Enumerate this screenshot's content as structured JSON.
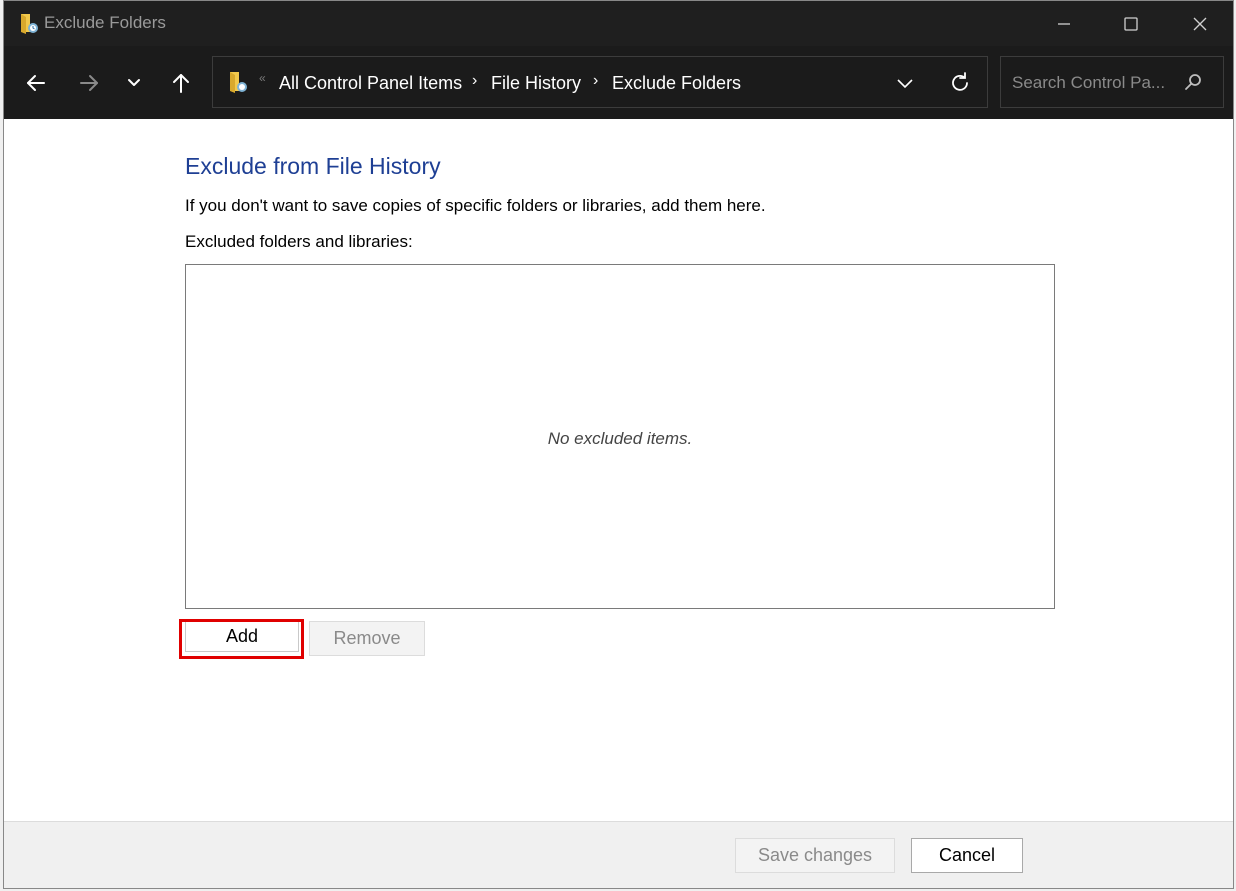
{
  "window": {
    "title": "Exclude Folders",
    "controls": {
      "minimize": "minimize-icon",
      "maximize": "maximize-icon",
      "close": "close-icon"
    }
  },
  "navbar": {
    "icons": [
      "back-arrow-icon",
      "forward-arrow-icon",
      "recent-locations-icon",
      "up-arrow-icon"
    ],
    "breadcrumb": {
      "items": [
        "All Control Panel Items",
        "File History",
        "Exclude Folders"
      ],
      "overflow_glyph": "«"
    },
    "search": {
      "placeholder": "Search Control Pa..."
    }
  },
  "main": {
    "heading": "Exclude from File History",
    "description": "If you don't want to save copies of specific folders or libraries, add them here.",
    "list_label": "Excluded folders and libraries:",
    "empty_text": "No excluded items.",
    "add_label": "Add",
    "remove_label": "Remove"
  },
  "footer": {
    "save_label": "Save changes",
    "cancel_label": "Cancel"
  },
  "colors": {
    "heading": "#1e3f94",
    "highlight": "#e00000",
    "titlebar": "#1f1f1f"
  }
}
